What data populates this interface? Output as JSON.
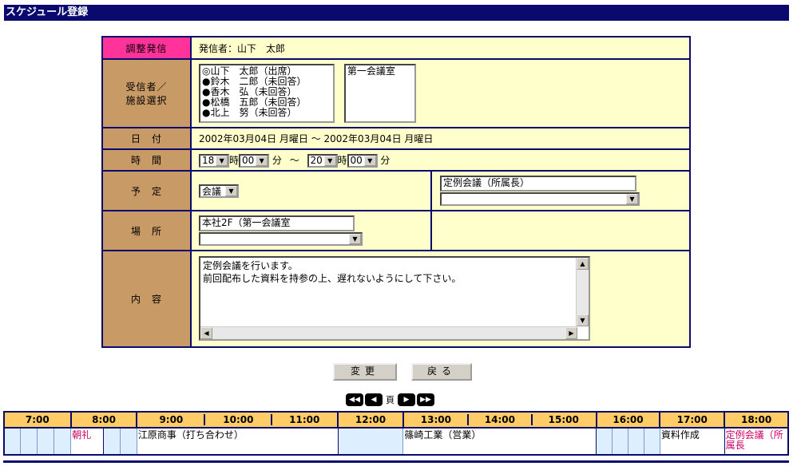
{
  "window_title": "スケジュール登録",
  "labels": {
    "sender": "調整発信",
    "recipients": [
      "受信者／",
      "施設選択"
    ],
    "date": "日　付",
    "time": "時　間",
    "plan": "予　定",
    "place": "場　所",
    "content": "内　容"
  },
  "sender_value": "発信者：山下　太郎",
  "recipients_list": [
    "◎山下　太郎（出席）",
    "●鈴木　二郎（未回答）",
    "●香木　弘（未回答）",
    "●松橋　五郎（未回答）",
    "●北上　努（未回答）"
  ],
  "facility_list": [
    "第一会議室"
  ],
  "date_value": "2002年03月04日 月曜日 ～ 2002年03月04日 月曜日",
  "time": {
    "start_hour": "18",
    "start_min": "00",
    "end_hour": "20",
    "end_min": "00",
    "hour_unit": "時",
    "min_unit": "分",
    "tilde": "～"
  },
  "plan": {
    "type_select": "会議",
    "title_input": "定例会議（所属長）",
    "title_select": ""
  },
  "place": {
    "input": "本社2F（第一会議室",
    "select": ""
  },
  "content_text": [
    "定例会議を行います。",
    "前回配布した資料を持参の上、遅れないようにして下さい。"
  ],
  "buttons": {
    "change": "変更",
    "back": "戻る"
  },
  "pager": {
    "first": "◀◀",
    "prev": "◀",
    "label": "頁",
    "next": "▶",
    "last": "▶▶"
  },
  "schedule": {
    "hours": [
      "7:00",
      "8:00",
      "9:00",
      "10:00",
      "11:00",
      "12:00",
      "13:00",
      "14:00",
      "15:00",
      "16:00",
      "17:00",
      "18:00"
    ],
    "events": {
      "morning": "朝礼",
      "ehara": "江原商事（打ち合わせ）",
      "shinozaki": "篠崎工業（営業）",
      "docs": "資料作成",
      "regular": "定例会議（所属長"
    }
  },
  "colors": {
    "navy": "#0a0a6e",
    "label_bg": "#c89a66",
    "pink_label": "#ff3399",
    "value_bg": "#ffffcc",
    "header_bg": "#ffcc66",
    "slot_bg": "#ddeeff"
  }
}
